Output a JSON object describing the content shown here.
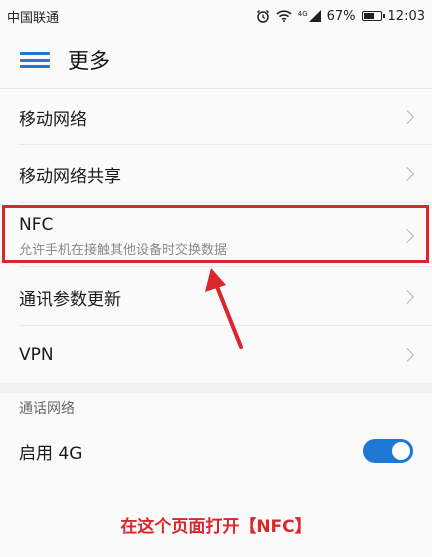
{
  "status_bar": {
    "carrier": "中国联通",
    "signal_label": "4G",
    "battery": "67%",
    "battery_level": 0.67,
    "time": "12:03"
  },
  "header": {
    "title": "更多",
    "menu_icon": "hamburger-menu-icon"
  },
  "settings": [
    {
      "label": "移动网络"
    },
    {
      "label": "移动网络共享"
    },
    {
      "label": "NFC",
      "sub": "允许手机在接触其他设备时交换数据"
    },
    {
      "label": "通讯参数更新"
    },
    {
      "label": "VPN"
    }
  ],
  "call_network": {
    "section_title": "通话网络",
    "enable_4g": {
      "label": "启用 4G",
      "enabled": true
    }
  },
  "annotation": {
    "caption": "在这个页面打开【NFC】",
    "color": "#d9272b"
  },
  "colors": {
    "accent": "#1d78d6"
  }
}
